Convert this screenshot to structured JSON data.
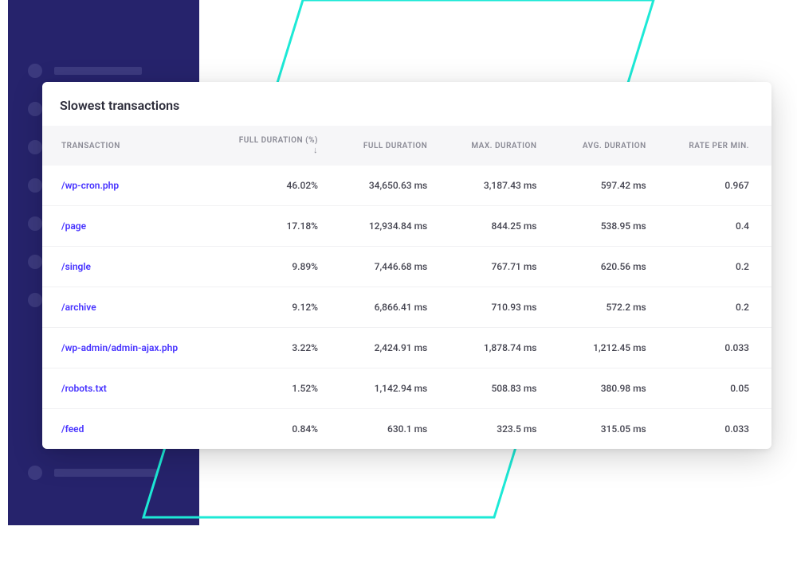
{
  "panel": {
    "title": "Slowest transactions"
  },
  "columns": {
    "transaction": "Transaction",
    "full_duration_pct": "Full Duration (%)",
    "full_duration": "Full Duration",
    "max_duration": "Max. Duration",
    "avg_duration": "Avg. Duration",
    "rate_per_min": "Rate per min."
  },
  "sort_indicator": "↓",
  "rows": [
    {
      "transaction": "/wp-cron.php",
      "full_pct": "46.02%",
      "full": "34,650.63 ms",
      "max": "3,187.43 ms",
      "avg": "597.42 ms",
      "rate": "0.967"
    },
    {
      "transaction": "/page",
      "full_pct": "17.18%",
      "full": "12,934.84 ms",
      "max": "844.25 ms",
      "avg": "538.95 ms",
      "rate": "0.4"
    },
    {
      "transaction": "/single",
      "full_pct": "9.89%",
      "full": "7,446.68 ms",
      "max": "767.71 ms",
      "avg": "620.56 ms",
      "rate": "0.2"
    },
    {
      "transaction": "/archive",
      "full_pct": "9.12%",
      "full": "6,866.41 ms",
      "max": "710.93 ms",
      "avg": "572.2 ms",
      "rate": "0.2"
    },
    {
      "transaction": "/wp-admin/admin-ajax.php",
      "full_pct": "3.22%",
      "full": "2,424.91 ms",
      "max": "1,878.74 ms",
      "avg": "1,212.45 ms",
      "rate": "0.033"
    },
    {
      "transaction": "/robots.txt",
      "full_pct": "1.52%",
      "full": "1,142.94 ms",
      "max": "508.83 ms",
      "avg": "380.98 ms",
      "rate": "0.05"
    },
    {
      "transaction": "/feed",
      "full_pct": "0.84%",
      "full": "630.1 ms",
      "max": "323.5 ms",
      "avg": "315.05 ms",
      "rate": "0.033"
    }
  ],
  "colors": {
    "panel_bg": "#26236c",
    "teal": "#1de9d6",
    "link": "#4733ff"
  }
}
